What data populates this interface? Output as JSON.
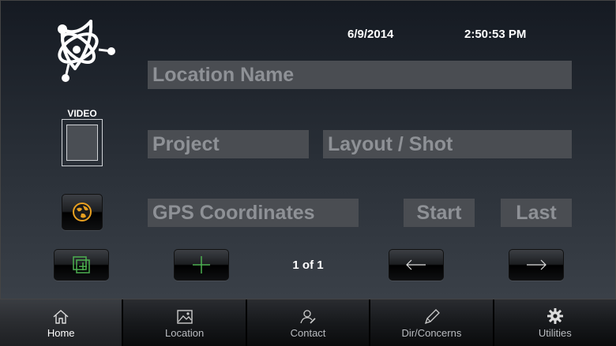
{
  "header": {
    "date": "6/9/2014",
    "time": "2:50:53 PM"
  },
  "fields": {
    "location_name": "Location Name",
    "project": "Project",
    "layout_shot": "Layout / Shot",
    "gps": "GPS Coordinates",
    "start": "Start",
    "last": "Last"
  },
  "video": {
    "label": "VIDEO"
  },
  "pager": {
    "text": "1 of 1"
  },
  "tabs": [
    {
      "label": "Home",
      "icon": "home-icon"
    },
    {
      "label": "Location",
      "icon": "image-icon"
    },
    {
      "label": "Contact",
      "icon": "contact-icon"
    },
    {
      "label": "Dir/Concerns",
      "icon": "pencil-icon"
    },
    {
      "label": "Utilities",
      "icon": "gear-icon"
    }
  ],
  "colors": {
    "field_bg": "#4a4d52",
    "field_text": "#8e9196",
    "accent_green": "#4caf50",
    "globe_orange": "#e8a020"
  }
}
